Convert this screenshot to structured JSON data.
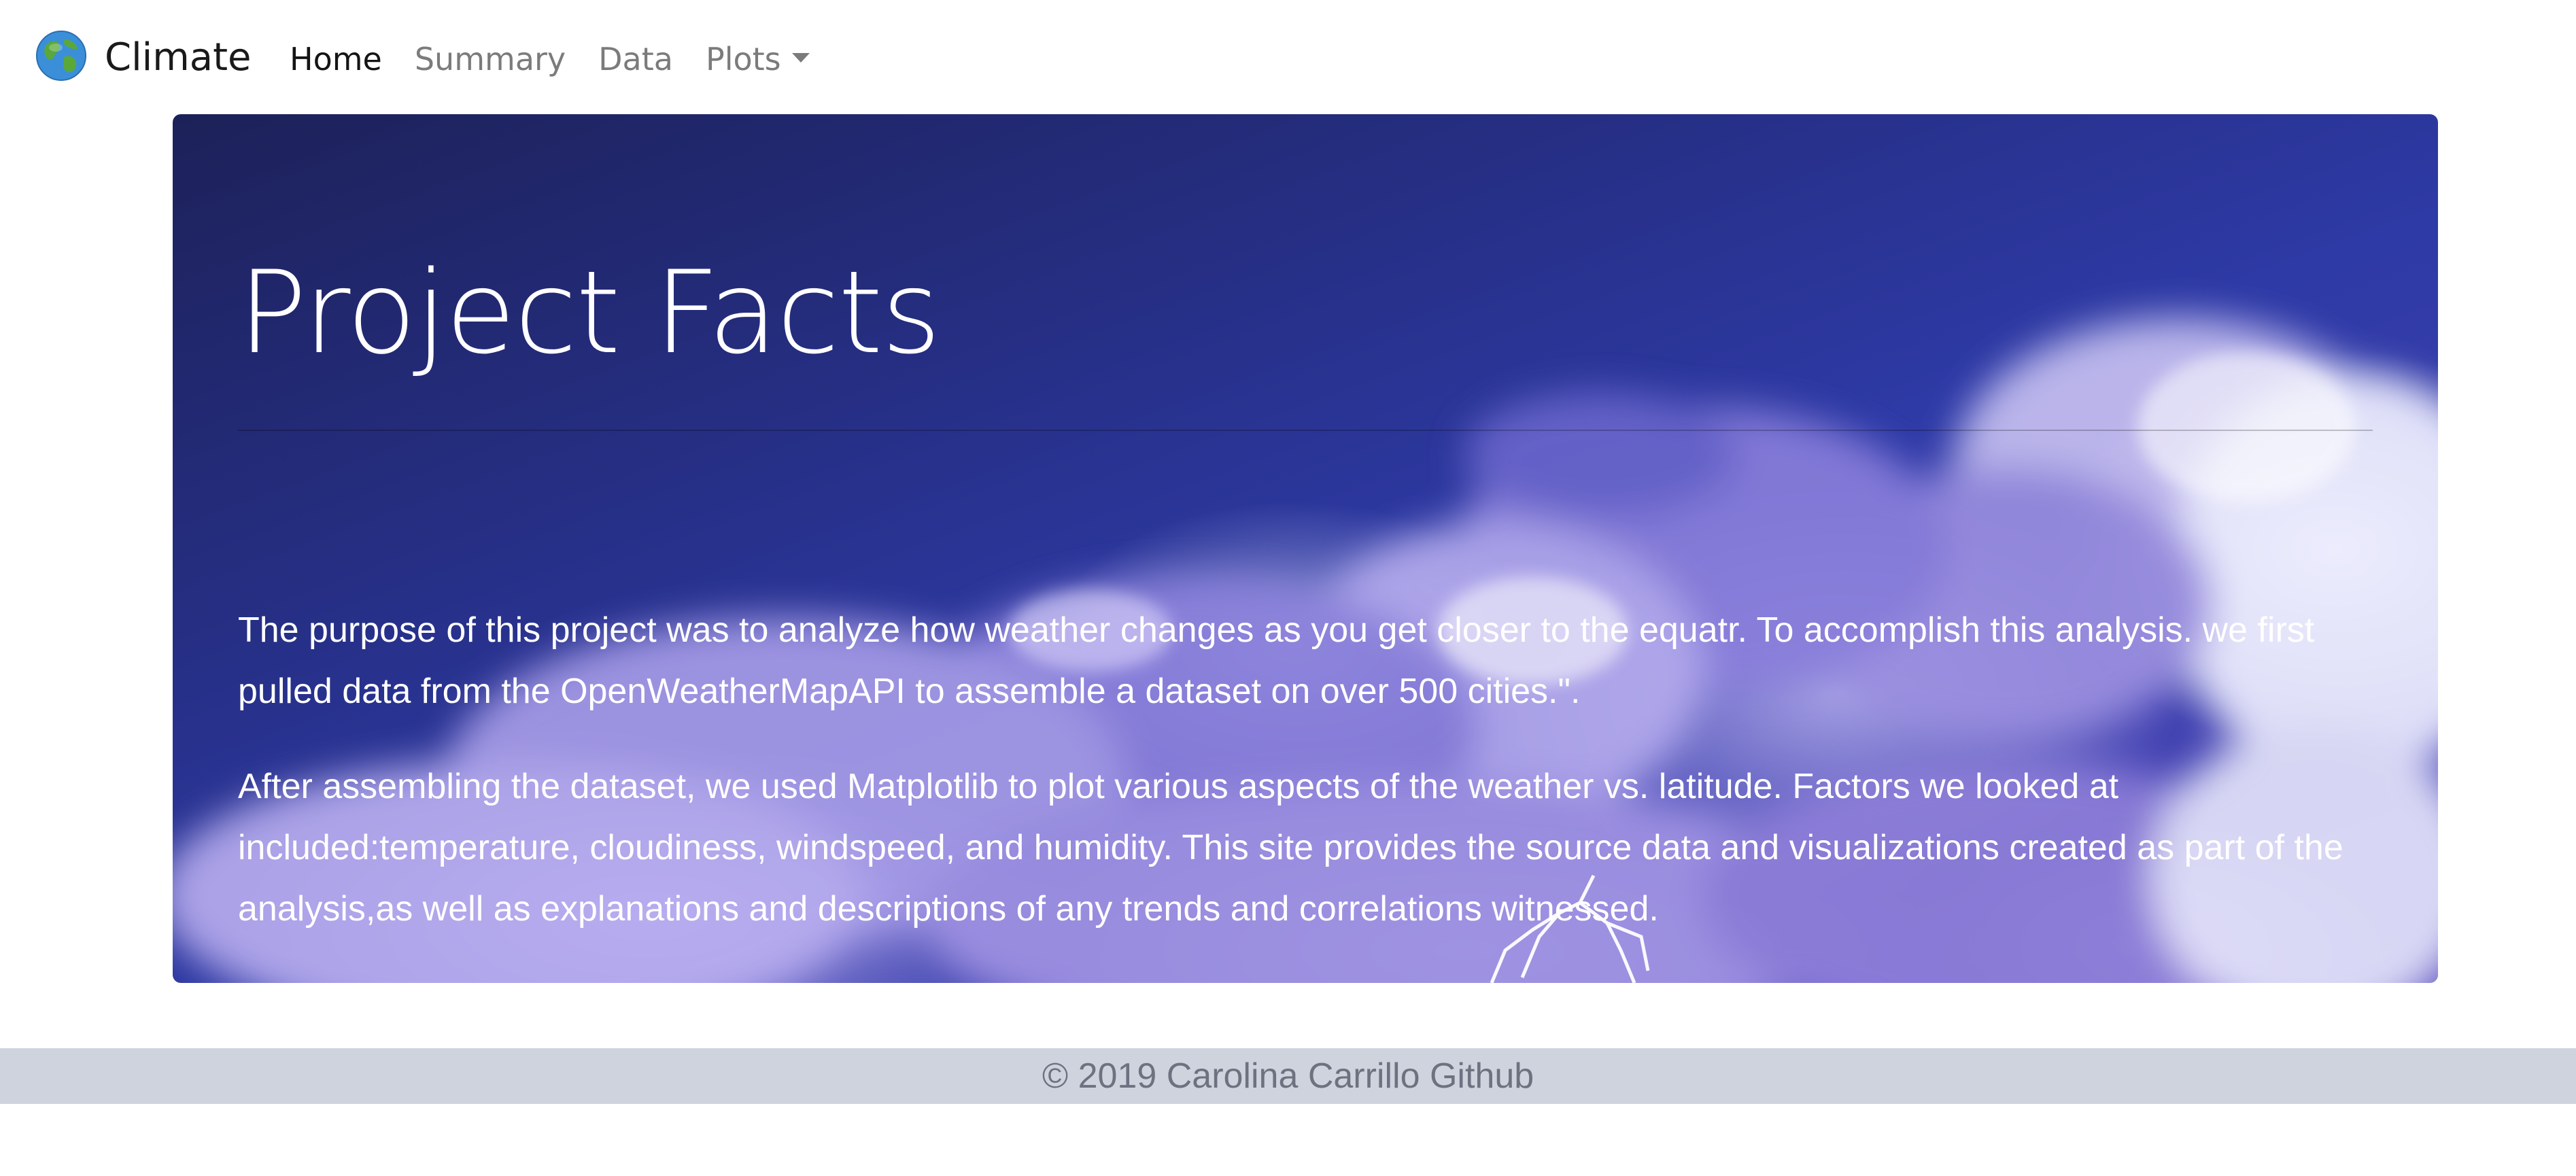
{
  "navbar": {
    "brand_name": "Climate",
    "brand_icon": "globe-icon",
    "links": [
      {
        "label": "Home",
        "active": true
      },
      {
        "label": "Summary",
        "active": false
      },
      {
        "label": "Data",
        "active": false
      },
      {
        "label": "Plots",
        "active": false,
        "dropdown": true
      }
    ]
  },
  "jumbotron": {
    "title": "Project Facts",
    "paragraphs": [
      "The purpose of this project was to analyze how weather changes as you get closer to the equatr. To accomplish this analysis. we first pulled data from the OpenWeatherMapAPI to assemble a dataset on over 500 cities.\".",
      "After assembling the dataset, we used Matplotlib to plot various aspects of the weather vs. latitude. Factors we looked at included:temperature, cloudiness, windspeed, and humidity. This site provides the source data and visualizations created as part of the analysis,as well as explanations and descriptions of any trends and correlations witnessed."
    ],
    "background": "storm-clouds-lightning-image"
  },
  "footer": {
    "text": "© 2019 Carolina Carrillo Github"
  },
  "colors": {
    "footer_bg": "#cfd3de",
    "nav_active": "#141414",
    "nav_inactive": "#7b7b7b",
    "jumbotron_dark": "#1d2159",
    "jumbotron_mid": "#2e3aa6"
  }
}
